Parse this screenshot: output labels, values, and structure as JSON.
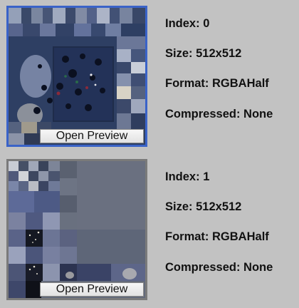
{
  "textures": [
    {
      "index_label": "Index:",
      "index_value": "0",
      "size_label": "Size:",
      "size_value": "512x512",
      "format_label": "Format:",
      "format_value": "RGBAHalf",
      "compressed_label": "Compressed:",
      "compressed_value": "None",
      "button_label": "Open Preview",
      "selected": true,
      "border_color": "#3a63c8"
    },
    {
      "index_label": "Index:",
      "index_value": "1",
      "size_label": "Size:",
      "size_value": "512x512",
      "format_label": "Format:",
      "format_value": "RGBAHalf",
      "compressed_label": "Compressed:",
      "compressed_value": "None",
      "button_label": "Open Preview",
      "selected": false,
      "border_color": "#7a7a7a"
    }
  ]
}
